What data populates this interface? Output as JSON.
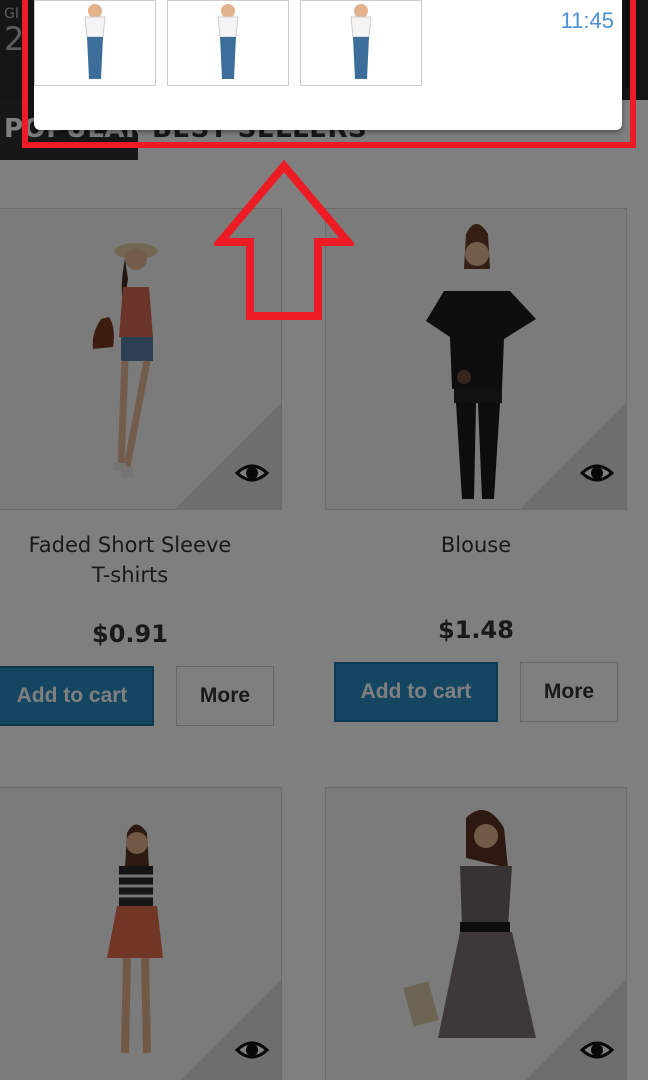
{
  "site": {
    "top_small": "GI",
    "top_number": "2"
  },
  "tabs": {
    "popular": "POPULAR",
    "best_sellers": "BEST SELLERS"
  },
  "notification": {
    "time": "11:45",
    "thumbnail_count": 3
  },
  "products": [
    {
      "name": "Faded Short Sleeve T-shirts",
      "price": "$0.91",
      "add_label": "Add to cart",
      "more_label": "More"
    },
    {
      "name": "Blouse",
      "price": "$1.48",
      "add_label": "Add to cart",
      "more_label": "More"
    },
    {
      "name": "",
      "price": "",
      "add_label": "",
      "more_label": ""
    },
    {
      "name": "",
      "price": "",
      "add_label": "",
      "more_label": ""
    }
  ],
  "colors": {
    "accent": "#2b8dc2",
    "highlight": "#ed1c24",
    "time": "#4a90d9"
  },
  "icons": {
    "quick_view": "eye-icon"
  }
}
